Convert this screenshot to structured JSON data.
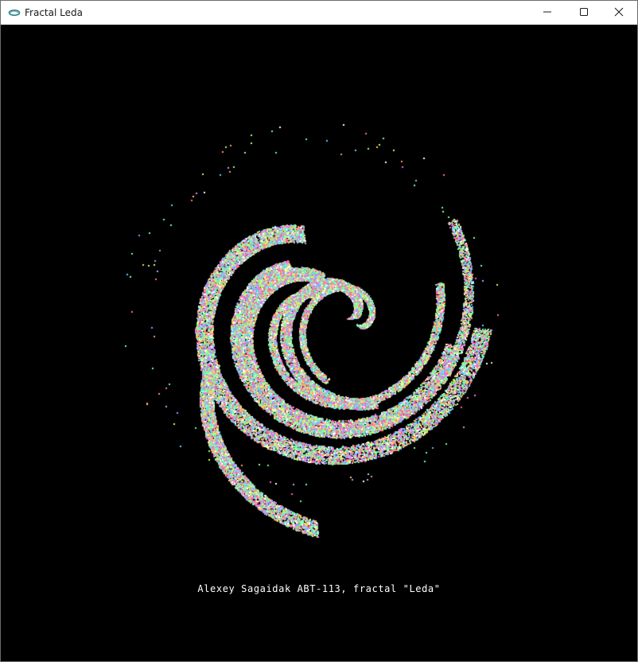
{
  "window": {
    "title": "Fractal Leda",
    "icon": "app-logo-icon",
    "controls": {
      "minimize": "minimize-icon",
      "maximize": "maximize-icon",
      "close": "close-icon"
    }
  },
  "canvas": {
    "background": "#000000",
    "caption": "Alexey Sagaidak ABT-113, fractal \"Leda\""
  }
}
